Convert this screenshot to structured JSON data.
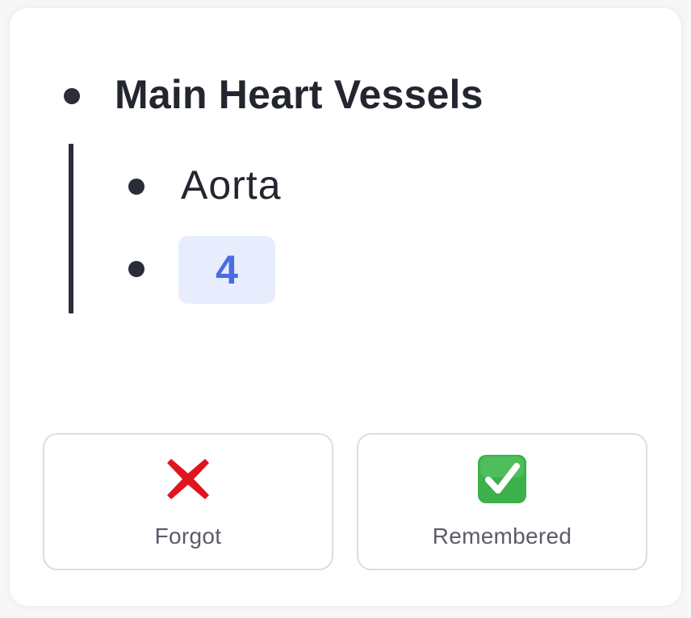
{
  "note": {
    "title": "Main Heart Vessels",
    "children": [
      {
        "text": "Aorta"
      },
      {
        "cloze": "4"
      }
    ]
  },
  "actions": {
    "forgot": {
      "label": "Forgot",
      "icon": "cross-mark-icon",
      "color": "#e0141e"
    },
    "remembered": {
      "label": "Remembered",
      "icon": "check-mark-button-icon",
      "color": "#3cb04a"
    }
  },
  "colors": {
    "text": "#23252f",
    "cloze_bg": "#e8edfd",
    "cloze_text": "#4a6ee0",
    "border": "#dcdce3"
  }
}
